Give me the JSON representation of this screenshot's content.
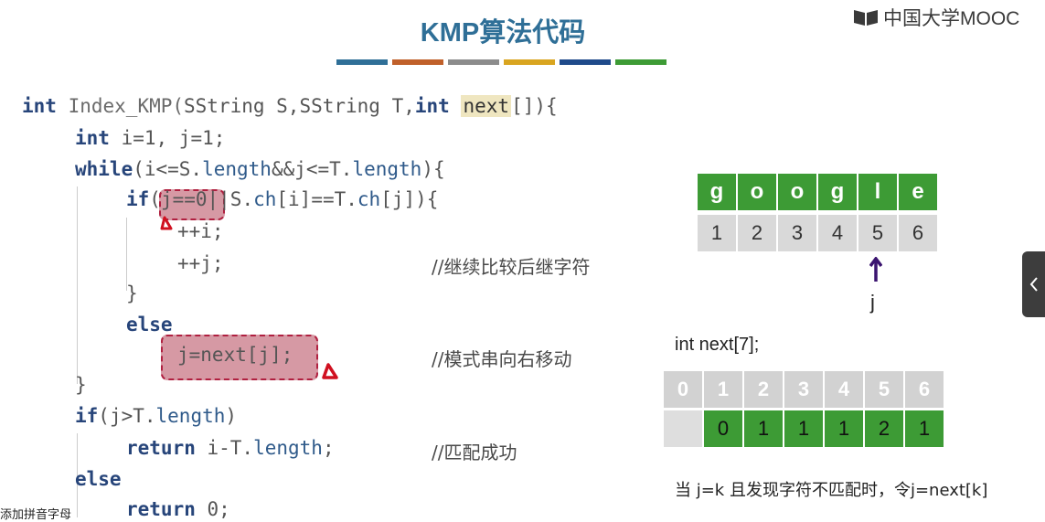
{
  "slide": {
    "title": "KMP算法代码",
    "logo_text": "中国大学MOOC",
    "stripe_colors": [
      "#2f6f97",
      "#c0602a",
      "#8c8c8c",
      "#d9a520",
      "#1f4a8a",
      "#3d9b35"
    ]
  },
  "code": {
    "l1": {
      "kw1": "int",
      "fn": " Index_KMP(",
      "t1": "SString S,SString T,",
      "kw2": "int",
      "sp": " ",
      "hl": "next",
      "end": "[]){"
    },
    "l2": {
      "kw": "int",
      "rest": " i=1, j=1;"
    },
    "l3": {
      "kw": "while",
      "a": "(i<=S.",
      "m1": "length",
      "b": "&&j<=T.",
      "m2": "length",
      "c": "){"
    },
    "l4": {
      "kw": "if",
      "a": "(j==0||S.",
      "m1": "ch",
      "b": "[i]==T.",
      "m2": "ch",
      "c": "[j]){"
    },
    "l5": "++i;",
    "l6": "++j;",
    "l6_comment": "//继续比较后继字符",
    "l7": "}",
    "l8": "else",
    "l9": "j=next[j];",
    "l9_comment": "//模式串向右移动",
    "l10": "}",
    "l11": {
      "kw": "if",
      "a": "(j>T.",
      "m": "length",
      "b": ")"
    },
    "l12": {
      "kw": "return",
      "a": " i-T.",
      "m": "length",
      "b": ";"
    },
    "l12_comment": "//匹配成功",
    "l13": "else",
    "l14": {
      "kw": "return",
      "b": " 0;"
    }
  },
  "pattern": {
    "chars": [
      "g",
      "o",
      "o",
      "g",
      "l",
      "e"
    ],
    "indices": [
      "1",
      "2",
      "3",
      "4",
      "5",
      "6"
    ],
    "pointer_label": "j",
    "pointer_index": 5
  },
  "next_array": {
    "decl": "int next[7];",
    "indices": [
      "0",
      "1",
      "2",
      "3",
      "4",
      "5",
      "6"
    ],
    "values": [
      "",
      "0",
      "1",
      "1",
      "1",
      "2",
      "1"
    ]
  },
  "note": "当 j=k 且发现字符不匹配时，令j=next[k]",
  "side_tab_icon": "chevron-left-icon",
  "caption": "添加拼音字母"
}
